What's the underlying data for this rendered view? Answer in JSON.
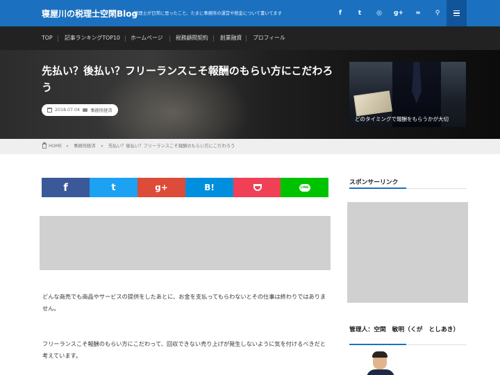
{
  "header": {
    "site_title": "寝屋川の税理士空閑Blog",
    "description": "税理士が日常に思ったこと、たまに事務所の運営や税金について書いてます",
    "social": [
      {
        "icon": "facebook-icon",
        "glyph": "f"
      },
      {
        "icon": "twitter-icon",
        "glyph": "t"
      },
      {
        "icon": "instagram-icon",
        "glyph": "◎"
      },
      {
        "icon": "googleplus-icon",
        "glyph": "g+"
      },
      {
        "icon": "rss-icon",
        "glyph": "≈"
      },
      {
        "icon": "search-icon",
        "glyph": "⚲"
      }
    ],
    "menu_icon": "menu-icon"
  },
  "nav": {
    "items": [
      "TOP",
      "記事ランキングTOP10",
      "ホームページ",
      "税務顧問契約",
      "創業融資",
      "プロフィール"
    ]
  },
  "hero": {
    "title": "先払い？後払い？フリーランスこそ報酬のもらい方にこだわろう",
    "date": "2018.07.04",
    "category": "事務所経済",
    "featured_caption": "どのタイミングで報酬をもらうかが大切"
  },
  "breadcrumb": {
    "home": "HOME",
    "sep": "»",
    "category": "事務所経済",
    "current": "先払い？後払い？フリーランスこそ報酬のもらい方にこだわろう"
  },
  "share": [
    {
      "name": "facebook",
      "glyph": "f",
      "color": "#3b5998"
    },
    {
      "name": "twitter",
      "glyph": "t",
      "color": "#1da1f2"
    },
    {
      "name": "googleplus",
      "glyph": "g+",
      "color": "#dd4b39"
    },
    {
      "name": "hatena",
      "glyph": "B!",
      "color": "#008fde"
    },
    {
      "name": "pocket",
      "glyph": "",
      "color": "#ef4056"
    },
    {
      "name": "line",
      "glyph": "LINE",
      "color": "#00c300"
    }
  ],
  "article": {
    "p1": "どんな商売でも商品やサービスの提供をしたあとに、お金を支払ってもらわないとその仕事は終わりではありません。",
    "p2": "フリーランスこそ報酬のもらい方にこだわって、回収できない売り上げが発生しないように気を付けるべきだと考えています。"
  },
  "sidebar": {
    "sponsor_heading": "スポンサーリンク",
    "admin_heading": "管理人：空閑　敏明（くが　としあき）"
  },
  "colors": {
    "header_bg": "#1b71c0",
    "nav_bg": "#222222",
    "accent": "#1b71c0"
  }
}
